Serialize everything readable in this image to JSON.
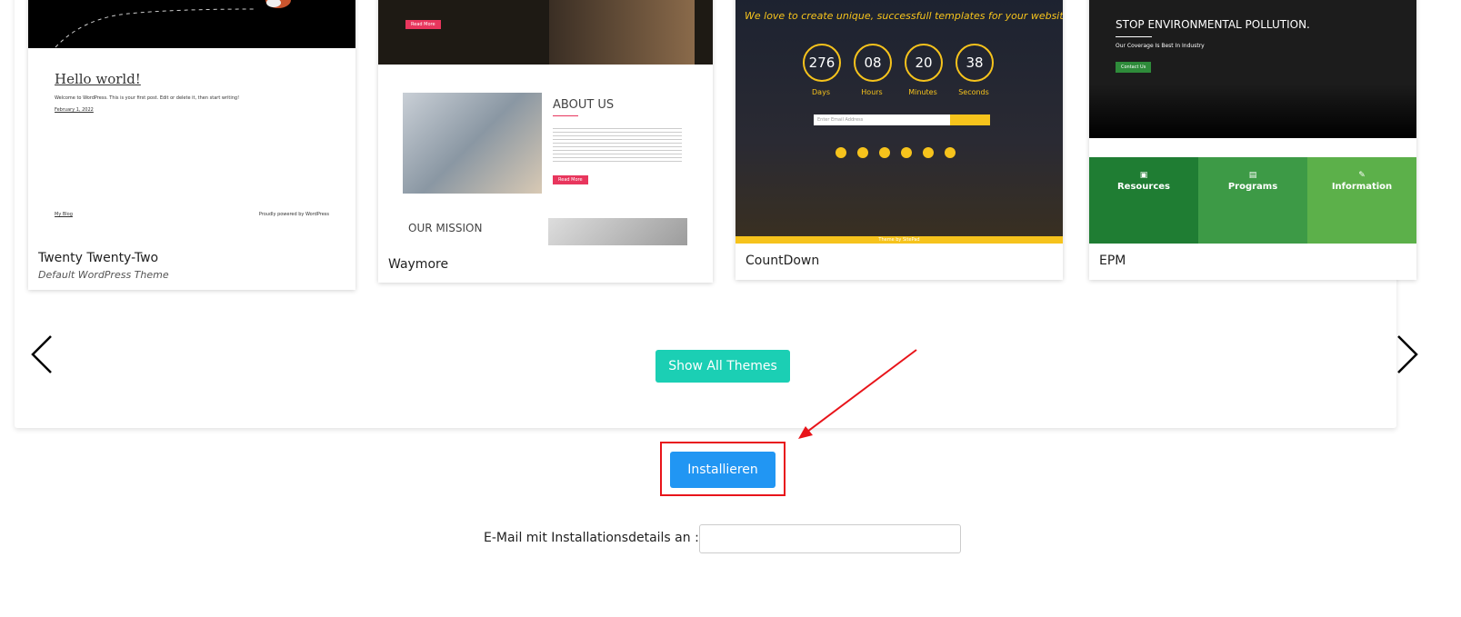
{
  "themes": [
    {
      "name": "Twenty Twenty-Two",
      "subtitle": "Default WordPress Theme",
      "preview": {
        "heading": "Hello world!",
        "text": "Welcome to WordPress. This is your first post. Edit or delete it, then start writing!",
        "date": "February 1, 2022",
        "footer_left": "My Blog",
        "footer_right": "Proudly powered by WordPress"
      }
    },
    {
      "name": "Waymore",
      "preview": {
        "about_heading": "ABOUT US",
        "mission_heading": "OUR MISSION",
        "button": "Read More"
      }
    },
    {
      "name": "CountDown",
      "preview": {
        "tagline": "We love to create unique, successfull templates for your websites",
        "counters": [
          {
            "value": "276",
            "label": "Days"
          },
          {
            "value": "08",
            "label": "Hours"
          },
          {
            "value": "20",
            "label": "Minutes"
          },
          {
            "value": "38",
            "label": "Seconds"
          }
        ],
        "email_placeholder": "Enter Email Address",
        "footer": "Theme by SitePad"
      }
    },
    {
      "name": "EPM",
      "preview": {
        "heading": "STOP ENVIRONMENTAL POLLUTION.",
        "subheading": "Our Coverage Is Best In Industry",
        "button": "Contact Us",
        "columns": [
          "Resources",
          "Programs",
          "Information"
        ]
      }
    }
  ],
  "show_all_label": "Show All Themes",
  "install_label": "Installieren",
  "email_label": "E-Mail mit Installationsdetails an :",
  "colors": {
    "teal": "#1bcfb4",
    "blue": "#2196f3",
    "red_annotation": "#e8141a"
  }
}
